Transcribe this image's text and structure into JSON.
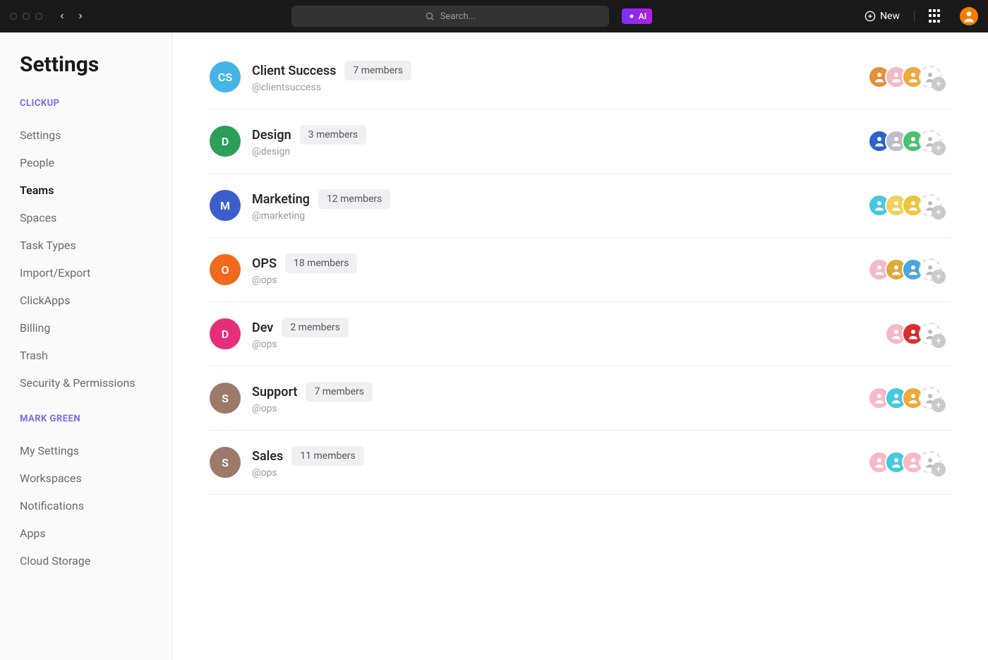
{
  "topbar": {
    "search_placeholder": "Search...",
    "ai_label": "AI",
    "new_label": "New"
  },
  "sidebar": {
    "title": "Settings",
    "sections": [
      {
        "header": "CLICKUP",
        "items": [
          {
            "label": "Settings",
            "active": false
          },
          {
            "label": "People",
            "active": false
          },
          {
            "label": "Teams",
            "active": true
          },
          {
            "label": "Spaces",
            "active": false
          },
          {
            "label": "Task Types",
            "active": false
          },
          {
            "label": "Import/Export",
            "active": false
          },
          {
            "label": "ClickApps",
            "active": false
          },
          {
            "label": "Billing",
            "active": false
          },
          {
            "label": "Trash",
            "active": false
          },
          {
            "label": "Security & Permissions",
            "active": false
          }
        ]
      },
      {
        "header": "MARK GREEN",
        "items": [
          {
            "label": "My Settings",
            "active": false
          },
          {
            "label": "Workspaces",
            "active": false
          },
          {
            "label": "Notifications",
            "active": false
          },
          {
            "label": "Apps",
            "active": false
          },
          {
            "label": "Cloud Storage",
            "active": false
          }
        ]
      }
    ]
  },
  "teams": [
    {
      "name": "Client Success",
      "handle": "@clientsuccess",
      "count": "7 members",
      "initials": "CS",
      "color": "#45b5e8",
      "member_colors": [
        "#e58f3a",
        "#f7b8c7",
        "#f0a93a"
      ]
    },
    {
      "name": "Design",
      "handle": "@design",
      "count": "3 members",
      "initials": "D",
      "color": "#2e9e5b",
      "member_colors": [
        "#2a63c9",
        "#bdbdcc",
        "#4ac26b"
      ]
    },
    {
      "name": "Marketing",
      "handle": "@marketing",
      "count": "12 members",
      "initials": "M",
      "color": "#3a5fcd",
      "member_colors": [
        "#46c8e0",
        "#f2d05a",
        "#f2c23a"
      ]
    },
    {
      "name": "OPS",
      "handle": "@ops",
      "count": "18 members",
      "initials": "O",
      "color": "#f06a1c",
      "member_colors": [
        "#f7b8c7",
        "#e0a93a",
        "#4aa6e0"
      ]
    },
    {
      "name": "Dev",
      "handle": "@ops",
      "count": "2 members",
      "initials": "D",
      "color": "#e62e7b",
      "member_colors": [
        "#f7b8c7",
        "#d82e2e"
      ]
    },
    {
      "name": "Support",
      "handle": "@ops",
      "count": "7 members",
      "initials": "S",
      "color": "#9c7a6a",
      "member_colors": [
        "#f7b8c7",
        "#46c8e0",
        "#f0a93a"
      ]
    },
    {
      "name": "Sales",
      "handle": "@ops",
      "count": "11 members",
      "initials": "S",
      "color": "#9c7a6a",
      "member_colors": [
        "#f7b8c7",
        "#46c8e0",
        "#f7b8c7"
      ]
    }
  ]
}
